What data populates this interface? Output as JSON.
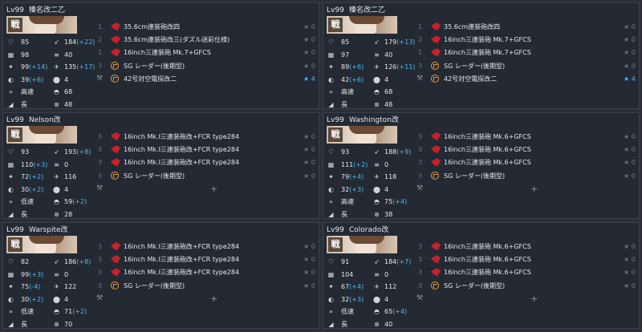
{
  "panels": [
    {
      "level": "Lv99",
      "name": "榛名改二乙",
      "kan": "戦",
      "stats": [
        {
          "i1": "♡",
          "v1": "85",
          "b1": "",
          "i2": "➶",
          "v2": "184",
          "b2": "(+22)"
        },
        {
          "i1": "▦",
          "v1": "98",
          "b1": "",
          "i2": "≡",
          "v2": "40",
          "b2": ""
        },
        {
          "i1": "✦",
          "v1": "99",
          "b1": "(+14)",
          "i2": "✈",
          "v2": "135",
          "b2": "(+17)"
        },
        {
          "i1": "◐",
          "v1": "39",
          "b1": "(+6)",
          "i2": "⬤",
          "v2": "4",
          "b2": ""
        },
        {
          "i1": "»",
          "v1": "高速",
          "b1": "",
          "i2": "◓",
          "v2": "68",
          "b2": ""
        },
        {
          "i1": "◢",
          "v1": "長",
          "b1": "",
          "i2": "⊗",
          "v2": "48",
          "b2": ""
        }
      ],
      "equips": [
        {
          "slot": "1",
          "icon": "gun",
          "name": "35.6cm連装砲改四",
          "star": "★ 0",
          "hi": false
        },
        {
          "slot": "2",
          "icon": "gun",
          "name": "35.6cm連装砲改三(ダズル迷彩仕様)",
          "star": "★ 0",
          "hi": false
        },
        {
          "slot": "1",
          "icon": "gun",
          "name": "16inch三連装砲 Mk.7+GFCS",
          "star": "★ 0",
          "hi": false
        },
        {
          "slot": "3",
          "icon": "radar",
          "name": "SG レーダー(後期型)",
          "star": "★ 0",
          "hi": false
        },
        {
          "slot": "",
          "icon": "radar",
          "name": "42号対空電探改二",
          "star": "★ 4",
          "hi": true,
          "ex": true
        }
      ]
    },
    {
      "level": "Lv99",
      "name": "榛名改二乙",
      "kan": "戦",
      "stats": [
        {
          "i1": "♡",
          "v1": "85",
          "b1": "",
          "i2": "➶",
          "v2": "179",
          "b2": "(+13)"
        },
        {
          "i1": "▦",
          "v1": "97",
          "b1": "",
          "i2": "≡",
          "v2": "40",
          "b2": ""
        },
        {
          "i1": "✦",
          "v1": "89",
          "b1": "(+6)",
          "i2": "✈",
          "v2": "126",
          "b2": "(+11)"
        },
        {
          "i1": "◐",
          "v1": "42",
          "b1": "(+6)",
          "i2": "⬤",
          "v2": "4",
          "b2": ""
        },
        {
          "i1": "»",
          "v1": "高速",
          "b1": "",
          "i2": "◓",
          "v2": "68",
          "b2": ""
        },
        {
          "i1": "◢",
          "v1": "長",
          "b1": "",
          "i2": "⊗",
          "v2": "48",
          "b2": ""
        }
      ],
      "equips": [
        {
          "slot": "1",
          "icon": "gun",
          "name": "35.6cm連装砲改四",
          "star": "★ 0",
          "hi": false
        },
        {
          "slot": "2",
          "icon": "gun",
          "name": "16inch三連装砲 Mk.7+GFCS",
          "star": "★ 0",
          "hi": false
        },
        {
          "slot": "1",
          "icon": "gun",
          "name": "16inch三連装砲 Mk.7+GFCS",
          "star": "★ 0",
          "hi": false
        },
        {
          "slot": "3",
          "icon": "radar",
          "name": "SG レーダー(後期型)",
          "star": "★ 0",
          "hi": false
        },
        {
          "slot": "",
          "icon": "radar",
          "name": "42号対空電探改二",
          "star": "★ 4",
          "hi": true,
          "ex": true
        }
      ]
    },
    {
      "level": "Lv99",
      "name": "Nelson改",
      "kan": "戦",
      "stats": [
        {
          "i1": "♡",
          "v1": "93",
          "b1": "",
          "i2": "➶",
          "v2": "193",
          "b2": "(+8)"
        },
        {
          "i1": "▦",
          "v1": "110",
          "b1": "(+3)",
          "i2": "≡",
          "v2": "0",
          "b2": ""
        },
        {
          "i1": "✦",
          "v1": "72",
          "b1": "(+2)",
          "i2": "✈",
          "v2": "116",
          "b2": ""
        },
        {
          "i1": "◐",
          "v1": "30",
          "b1": "(+2)",
          "i2": "⬤",
          "v2": "4",
          "b2": ""
        },
        {
          "i1": "»",
          "v1": "低速",
          "b1": "",
          "i2": "◓",
          "v2": "59",
          "b2": "(+2)"
        },
        {
          "i1": "◢",
          "v1": "長",
          "b1": "",
          "i2": "⊗",
          "v2": "28",
          "b2": ""
        }
      ],
      "equips": [
        {
          "slot": "3",
          "icon": "gun",
          "name": "16inch Mk.I三連装砲改+FCR type284",
          "star": "★ 0",
          "hi": false
        },
        {
          "slot": "3",
          "icon": "gun",
          "name": "16inch Mk.I三連装砲改+FCR type284",
          "star": "★ 0",
          "hi": false
        },
        {
          "slot": "3",
          "icon": "gun",
          "name": "16inch Mk.I三連装砲改+FCR type284",
          "star": "★ 0",
          "hi": false
        },
        {
          "slot": "3",
          "icon": "radar",
          "name": "SG レーダー(後期型)",
          "star": "★ 0",
          "hi": false
        },
        {
          "slot": "",
          "icon": "",
          "name": "",
          "star": "",
          "hi": false,
          "ex": true,
          "plus": "+"
        }
      ]
    },
    {
      "level": "Lv99",
      "name": "Washington改",
      "kan": "戦",
      "stats": [
        {
          "i1": "♡",
          "v1": "93",
          "b1": "",
          "i2": "➶",
          "v2": "188",
          "b2": "(+9)"
        },
        {
          "i1": "▦",
          "v1": "111",
          "b1": "(+2)",
          "i2": "≡",
          "v2": "0",
          "b2": ""
        },
        {
          "i1": "✦",
          "v1": "79",
          "b1": "(+4)",
          "i2": "✈",
          "v2": "118",
          "b2": ""
        },
        {
          "i1": "◐",
          "v1": "32",
          "b1": "(+3)",
          "i2": "⬤",
          "v2": "4",
          "b2": ""
        },
        {
          "i1": "»",
          "v1": "高速",
          "b1": "",
          "i2": "◓",
          "v2": "75",
          "b2": "(+4)"
        },
        {
          "i1": "◢",
          "v1": "長",
          "b1": "",
          "i2": "⊗",
          "v2": "38",
          "b2": ""
        }
      ],
      "equips": [
        {
          "slot": "3",
          "icon": "gun",
          "name": "16inch三連装砲 Mk.6+GFCS",
          "star": "★ 0",
          "hi": false
        },
        {
          "slot": "3",
          "icon": "gun",
          "name": "16inch三連装砲 Mk.6+GFCS",
          "star": "★ 0",
          "hi": false
        },
        {
          "slot": "3",
          "icon": "gun",
          "name": "16inch三連装砲 Mk.6+GFCS",
          "star": "★ 0",
          "hi": false
        },
        {
          "slot": "3",
          "icon": "radar",
          "name": "SG レーダー(後期型)",
          "star": "★ 0",
          "hi": false
        },
        {
          "slot": "",
          "icon": "",
          "name": "",
          "star": "",
          "hi": false,
          "ex": true,
          "plus": "+"
        }
      ]
    },
    {
      "level": "Lv99",
      "name": "Warspite改",
      "kan": "戦",
      "stats": [
        {
          "i1": "♡",
          "v1": "82",
          "b1": "",
          "i2": "➶",
          "v2": "186",
          "b2": "(+8)"
        },
        {
          "i1": "▦",
          "v1": "99",
          "b1": "(+3)",
          "i2": "≡",
          "v2": "0",
          "b2": ""
        },
        {
          "i1": "✦",
          "v1": "75",
          "b1": "(-4)",
          "i2": "✈",
          "v2": "122",
          "b2": ""
        },
        {
          "i1": "◐",
          "v1": "30",
          "b1": "(+2)",
          "i2": "⬤",
          "v2": "4",
          "b2": ""
        },
        {
          "i1": "»",
          "v1": "低速",
          "b1": "",
          "i2": "◓",
          "v2": "71",
          "b2": "(+2)"
        },
        {
          "i1": "◢",
          "v1": "長",
          "b1": "",
          "i2": "⊗",
          "v2": "70",
          "b2": ""
        }
      ],
      "equips": [
        {
          "slot": "3",
          "icon": "gun",
          "name": "16inch Mk.I三連装砲改+FCR type284",
          "star": "★ 0",
          "hi": false
        },
        {
          "slot": "3",
          "icon": "gun",
          "name": "16inch Mk.I三連装砲改+FCR type284",
          "star": "★ 0",
          "hi": false
        },
        {
          "slot": "3",
          "icon": "gun",
          "name": "16inch Mk.I三連装砲改+FCR type284",
          "star": "★ 0",
          "hi": false
        },
        {
          "slot": "3",
          "icon": "radar",
          "name": "SG レーダー(後期型)",
          "star": "★ 0",
          "hi": false
        },
        {
          "slot": "",
          "icon": "",
          "name": "",
          "star": "",
          "hi": false,
          "ex": true,
          "plus": "+"
        }
      ]
    },
    {
      "level": "Lv99",
      "name": "Colorado改",
      "kan": "戦",
      "stats": [
        {
          "i1": "♡",
          "v1": "91",
          "b1": "",
          "i2": "➶",
          "v2": "184",
          "b2": "(+7)"
        },
        {
          "i1": "▦",
          "v1": "104",
          "b1": "",
          "i2": "≡",
          "v2": "0",
          "b2": ""
        },
        {
          "i1": "✦",
          "v1": "67",
          "b1": "(+4)",
          "i2": "✈",
          "v2": "112",
          "b2": ""
        },
        {
          "i1": "◐",
          "v1": "32",
          "b1": "(+3)",
          "i2": "⬤",
          "v2": "4",
          "b2": ""
        },
        {
          "i1": "»",
          "v1": "低速",
          "b1": "",
          "i2": "◓",
          "v2": "65",
          "b2": "(+4)"
        },
        {
          "i1": "◢",
          "v1": "長",
          "b1": "",
          "i2": "⊗",
          "v2": "40",
          "b2": ""
        }
      ],
      "equips": [
        {
          "slot": "3",
          "icon": "gun",
          "name": "16inch三連装砲 Mk.6+GFCS",
          "star": "★ 0",
          "hi": false
        },
        {
          "slot": "3",
          "icon": "gun",
          "name": "16inch三連装砲 Mk.6+GFCS",
          "star": "★ 0",
          "hi": false
        },
        {
          "slot": "3",
          "icon": "gun",
          "name": "16inch三連装砲 Mk.6+GFCS",
          "star": "★ 0",
          "hi": false
        },
        {
          "slot": "3",
          "icon": "radar",
          "name": "SG レーダー(後期型)",
          "star": "★ 0",
          "hi": false
        },
        {
          "slot": "",
          "icon": "",
          "name": "",
          "star": "",
          "hi": false,
          "ex": true,
          "plus": "+"
        }
      ]
    }
  ]
}
